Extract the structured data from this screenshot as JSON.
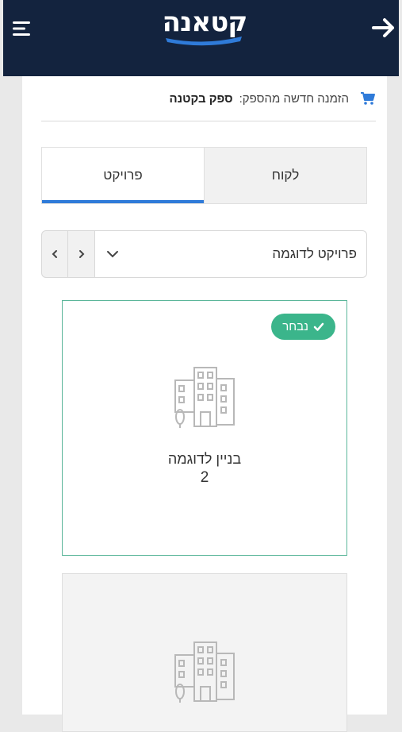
{
  "header": {
    "logo": "קטאנה",
    "menu_icon": "hamburger-menu-icon",
    "back_icon": "arrow-right-icon",
    "bg_color": "#13233e"
  },
  "order": {
    "icon": "shopping-cart-icon",
    "label": "הזמנה חדשה מהספק:",
    "supplier": "ספק בקטנה"
  },
  "tabs": [
    {
      "label": "לקוח",
      "active": false
    },
    {
      "label": "פרויקט",
      "active": true
    }
  ],
  "project_select": {
    "value": "פרויקט לדוגמה",
    "prev_icon": "chevron-left-icon",
    "next_icon": "chevron-right-icon",
    "dropdown_icon": "chevron-down-icon"
  },
  "buildings": [
    {
      "title": "בניין לדוגמה",
      "number": "2",
      "selected": true,
      "badge": "נבחר"
    },
    {
      "title": "",
      "number": "",
      "selected": false
    }
  ],
  "colors": {
    "accent_blue": "#2f7bd9",
    "selected_green": "#3bb58b",
    "selected_border": "#5bb69a"
  }
}
